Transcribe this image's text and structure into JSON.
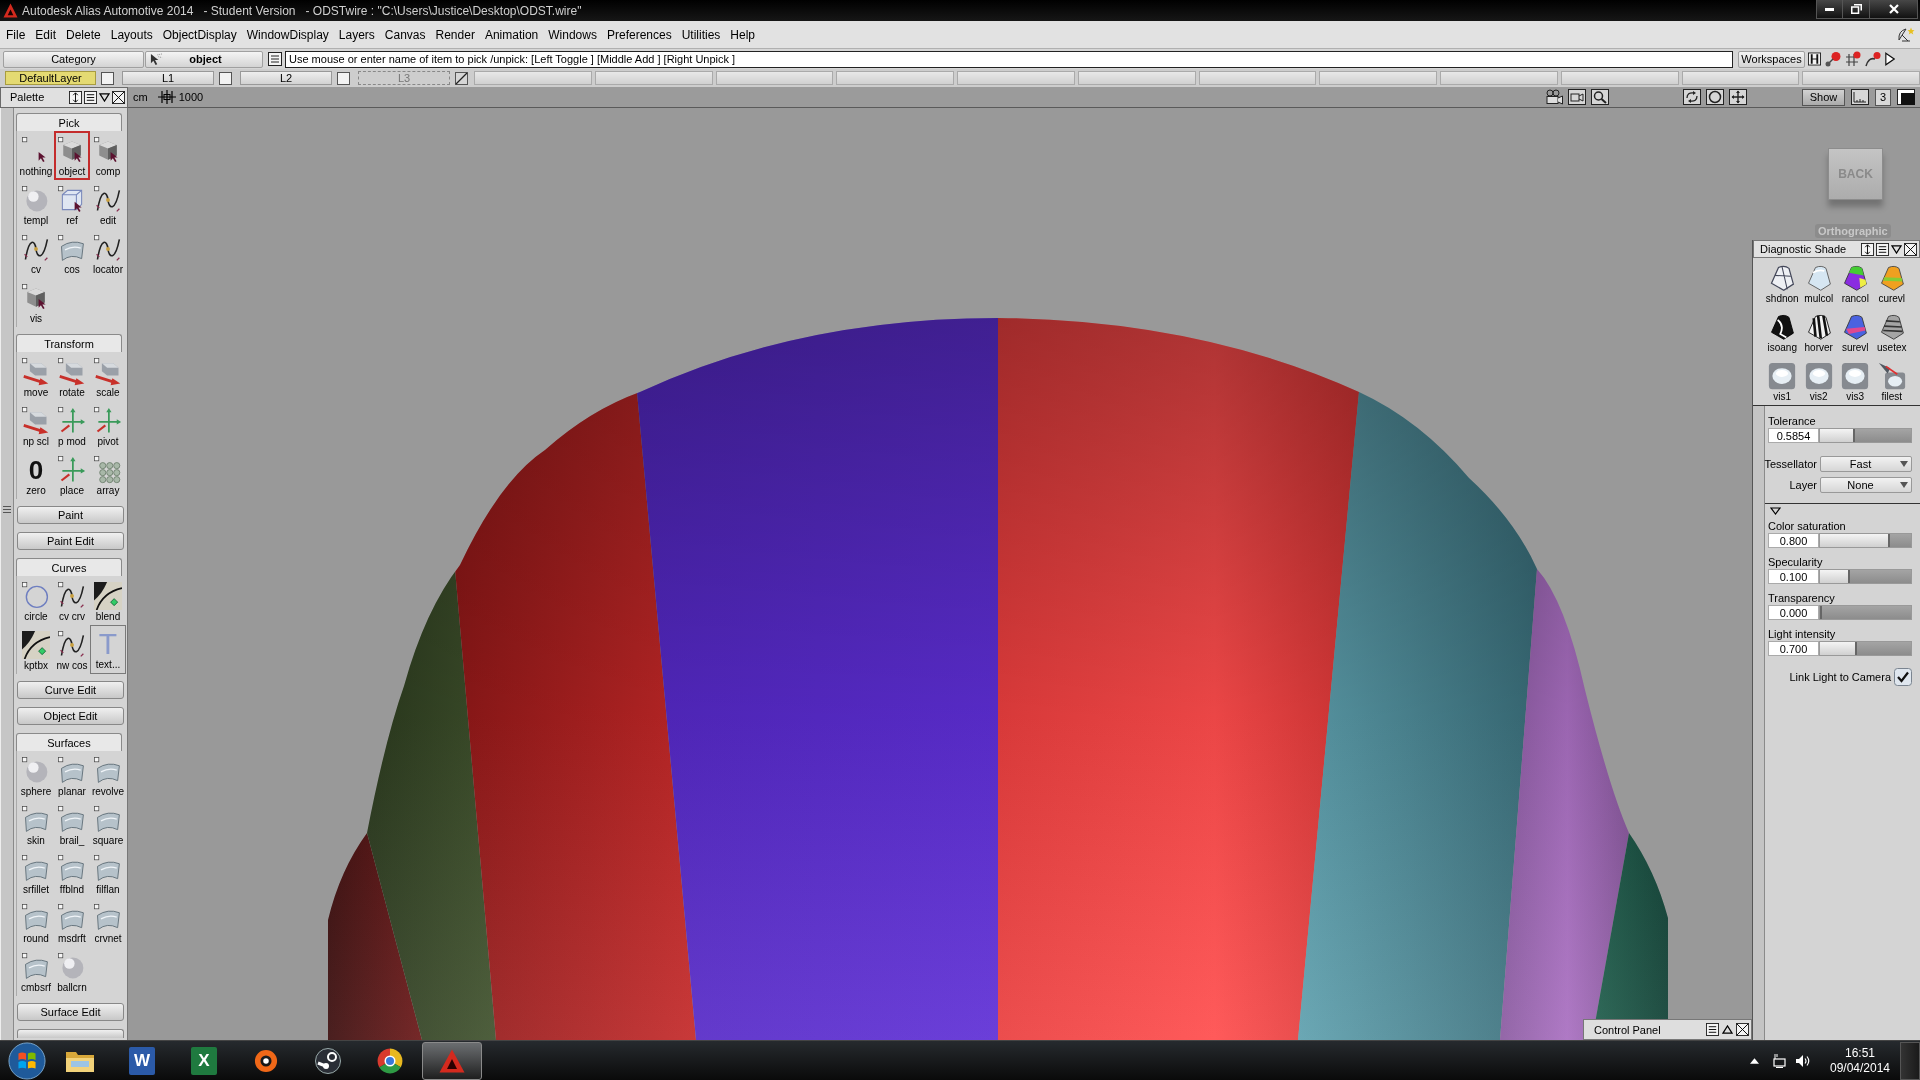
{
  "window": {
    "title": "Autodesk Alias Automotive 2014   - Student Version   - ODSTwire : \"C:\\Users\\Justice\\Desktop\\ODST.wire\""
  },
  "menu": [
    "File",
    "Edit",
    "Delete",
    "Layouts",
    "ObjectDisplay",
    "WindowDisplay",
    "Layers",
    "Canvas",
    "Render",
    "Animation",
    "Windows",
    "Preferences",
    "Utilities",
    "Help"
  ],
  "pick_bar": {
    "category_button": "Category",
    "pick_button": "object",
    "prompt": "Use mouse or enter name of item to pick /unpick: [Left Toggle ] [Middle Add ] [Right Unpick ]",
    "workspaces_button": "Workspaces"
  },
  "layers": [
    {
      "kind": "default",
      "label": "DefaultLayer",
      "checked": false
    },
    {
      "kind": "layer",
      "label": "L1",
      "checked": false
    },
    {
      "kind": "layer",
      "label": "L2",
      "checked": false
    },
    {
      "kind": "inactive",
      "label": "L3",
      "checked": false
    },
    {
      "kind": "empty"
    },
    {
      "kind": "empty"
    },
    {
      "kind": "empty"
    },
    {
      "kind": "empty"
    },
    {
      "kind": "empty"
    },
    {
      "kind": "empty"
    },
    {
      "kind": "empty"
    },
    {
      "kind": "empty"
    },
    {
      "kind": "empty"
    },
    {
      "kind": "empty"
    },
    {
      "kind": "empty"
    },
    {
      "kind": "empty"
    }
  ],
  "palette": {
    "title": "Palette",
    "sections": [
      {
        "title": "Pick",
        "expanded": true,
        "tools": [
          {
            "label": "nothing",
            "selected": false,
            "highlighted": false
          },
          {
            "label": "object",
            "selected": true,
            "highlighted": false
          },
          {
            "label": "comp",
            "selected": false,
            "highlighted": false
          },
          {
            "label": "templ",
            "selected": false,
            "highlighted": false
          },
          {
            "label": "ref",
            "selected": false,
            "highlighted": false
          },
          {
            "label": "edit",
            "selected": false,
            "highlighted": false
          },
          {
            "label": "cv",
            "selected": false,
            "highlighted": false
          },
          {
            "label": "cos",
            "selected": false,
            "highlighted": false
          },
          {
            "label": "locator",
            "selected": false,
            "highlighted": false
          },
          {
            "label": "vis",
            "selected": false,
            "highlighted": false
          }
        ]
      },
      {
        "title": "Transform",
        "expanded": true,
        "tools": [
          {
            "label": "move",
            "selected": false,
            "highlighted": false
          },
          {
            "label": "rotate",
            "selected": false,
            "highlighted": false
          },
          {
            "label": "scale",
            "selected": false,
            "highlighted": false
          },
          {
            "label": "np scl",
            "selected": false,
            "highlighted": false
          },
          {
            "label": "p mod",
            "selected": false,
            "highlighted": false
          },
          {
            "label": "pivot",
            "selected": false,
            "highlighted": false
          },
          {
            "label": "zero",
            "glyph": "0",
            "selected": false,
            "highlighted": false
          },
          {
            "label": "place",
            "selected": false,
            "highlighted": false
          },
          {
            "label": "array",
            "selected": false,
            "highlighted": false
          }
        ]
      },
      {
        "title": "Paint",
        "expanded": false
      },
      {
        "title": "Paint Edit",
        "expanded": false
      },
      {
        "title": "Curves",
        "expanded": true,
        "tools": [
          {
            "label": "circle",
            "selected": false,
            "highlighted": false
          },
          {
            "label": "cv crv",
            "selected": false,
            "highlighted": false
          },
          {
            "label": "blend",
            "selected": false,
            "highlighted": false
          },
          {
            "label": "kptbx",
            "selected": false,
            "highlighted": false
          },
          {
            "label": "nw cos",
            "selected": false,
            "highlighted": false
          },
          {
            "label": "text...",
            "glyph": "T",
            "selected": false,
            "highlighted": true
          }
        ]
      },
      {
        "title": "Curve Edit",
        "expanded": false
      },
      {
        "title": "Object Edit",
        "expanded": false
      },
      {
        "title": "Surfaces",
        "expanded": true,
        "tools": [
          {
            "label": "sphere",
            "selected": false,
            "highlighted": false
          },
          {
            "label": "planar",
            "selected": false,
            "highlighted": false
          },
          {
            "label": "revolve",
            "selected": false,
            "highlighted": false
          },
          {
            "label": "skin",
            "selected": false,
            "highlighted": false
          },
          {
            "label": "brail_",
            "selected": false,
            "highlighted": false
          },
          {
            "label": "square",
            "selected": false,
            "highlighted": false
          },
          {
            "label": "srfillet",
            "selected": false,
            "highlighted": false
          },
          {
            "label": "ffblnd",
            "selected": false,
            "highlighted": false
          },
          {
            "label": "filflan",
            "selected": false,
            "highlighted": false
          },
          {
            "label": "round",
            "selected": false,
            "highlighted": false
          },
          {
            "label": "msdrft",
            "selected": false,
            "highlighted": false
          },
          {
            "label": "crvnet",
            "selected": false,
            "highlighted": false
          },
          {
            "label": "cmbsrf",
            "selected": false,
            "highlighted": false
          },
          {
            "label": "ballcrn",
            "selected": false,
            "highlighted": false
          }
        ]
      },
      {
        "title": "Surface Edit",
        "expanded": false
      },
      {
        "expanded": false
      }
    ]
  },
  "viewport": {
    "units": "cm",
    "grid_spacing": "1000",
    "show_button": "Show",
    "layout_button": "3",
    "view_cube": "BACK",
    "projection": "Orthographic"
  },
  "diagnostic_shade": {
    "title": "Diagnostic Shade",
    "modes": [
      "shdnon",
      "mulcol",
      "rancol",
      "curevl",
      "isoang",
      "horver",
      "surevl",
      "usetex",
      "vis1",
      "vis2",
      "vis3",
      "filest"
    ],
    "controls": [
      {
        "kind": "slider",
        "label": "Tolerance",
        "value": "0.5854",
        "level": 0.38
      },
      {
        "kind": "dropdown",
        "label": "Tessellator",
        "value": "Fast"
      },
      {
        "kind": "dropdown",
        "label": "Layer",
        "value": "None"
      },
      {
        "kind": "group",
        "expanded": true
      },
      {
        "kind": "slider",
        "label": "Color saturation",
        "value": "0.800",
        "level": 0.77
      },
      {
        "kind": "slider",
        "label": "Specularity",
        "value": "0.100",
        "level": 0.33
      },
      {
        "kind": "slider",
        "label": "Transparency",
        "value": "0.000",
        "level": 0
      },
      {
        "kind": "slider",
        "label": "Light intensity",
        "value": "0.700",
        "level": 0.41
      },
      {
        "kind": "checkbox",
        "label": "Link Light to Camera",
        "checked": true
      }
    ]
  },
  "control_panel": {
    "title": "Control Panel"
  },
  "taskbar": {
    "apps": [
      {
        "kind": "folder",
        "selected": false
      },
      {
        "kind": "tile",
        "glyph": "W",
        "color": "#2b5aa8",
        "selected": false
      },
      {
        "kind": "tile",
        "glyph": "X",
        "color": "#1f7a3f",
        "selected": false
      },
      {
        "kind": "ring",
        "selected": false
      },
      {
        "kind": "piston",
        "selected": false
      },
      {
        "kind": "tricolor",
        "selected": false
      },
      {
        "kind": "triangle",
        "selected": true
      }
    ],
    "time": "16:51",
    "date": "09/04/2014"
  }
}
